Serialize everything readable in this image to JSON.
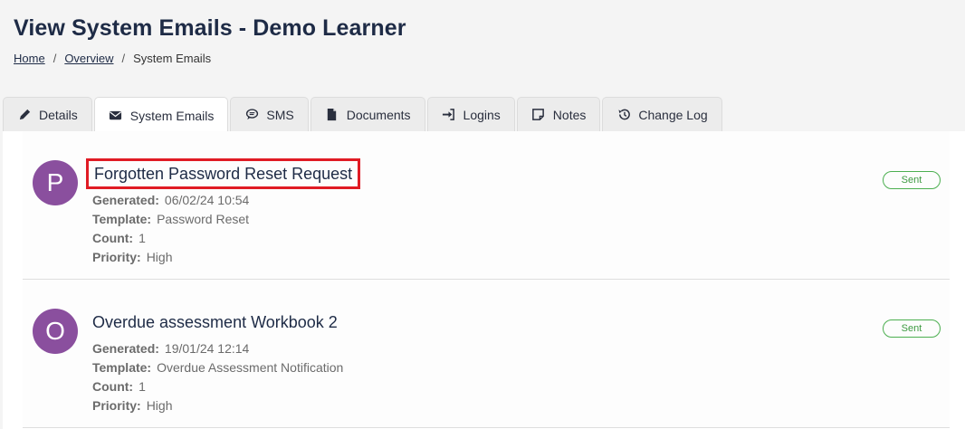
{
  "page": {
    "title": "View System Emails - Demo Learner"
  },
  "breadcrumb": {
    "items": [
      "Home",
      "Overview",
      "System Emails"
    ],
    "separator": "/"
  },
  "tabs": [
    {
      "label": "Details",
      "icon": "pencil-icon"
    },
    {
      "label": "System Emails",
      "icon": "envelope-icon",
      "active": true
    },
    {
      "label": "SMS",
      "icon": "chat-bubble-icon"
    },
    {
      "label": "Documents",
      "icon": "file-icon"
    },
    {
      "label": "Logins",
      "icon": "sign-in-icon"
    },
    {
      "label": "Notes",
      "icon": "sticky-note-icon"
    },
    {
      "label": "Change Log",
      "icon": "history-icon"
    }
  ],
  "labels": {
    "generated": "Generated:",
    "template": "Template:",
    "count": "Count:",
    "priority": "Priority:"
  },
  "emails": [
    {
      "initial": "P",
      "subject": "Forgotten Password Reset Request",
      "generated": "06/02/24 10:54",
      "template": "Password Reset",
      "count": "1",
      "priority": "High",
      "status": "Sent"
    },
    {
      "initial": "O",
      "subject": "Overdue assessment Workbook 2",
      "generated": "19/01/24 12:14",
      "template": "Overdue Assessment Notification",
      "count": "1",
      "priority": "High",
      "status": "Sent"
    }
  ],
  "colors": {
    "avatar": "#8a4f9e",
    "sent_badge": "#4caf50",
    "highlight_box": "#e01b24",
    "title": "#1e2b46"
  }
}
